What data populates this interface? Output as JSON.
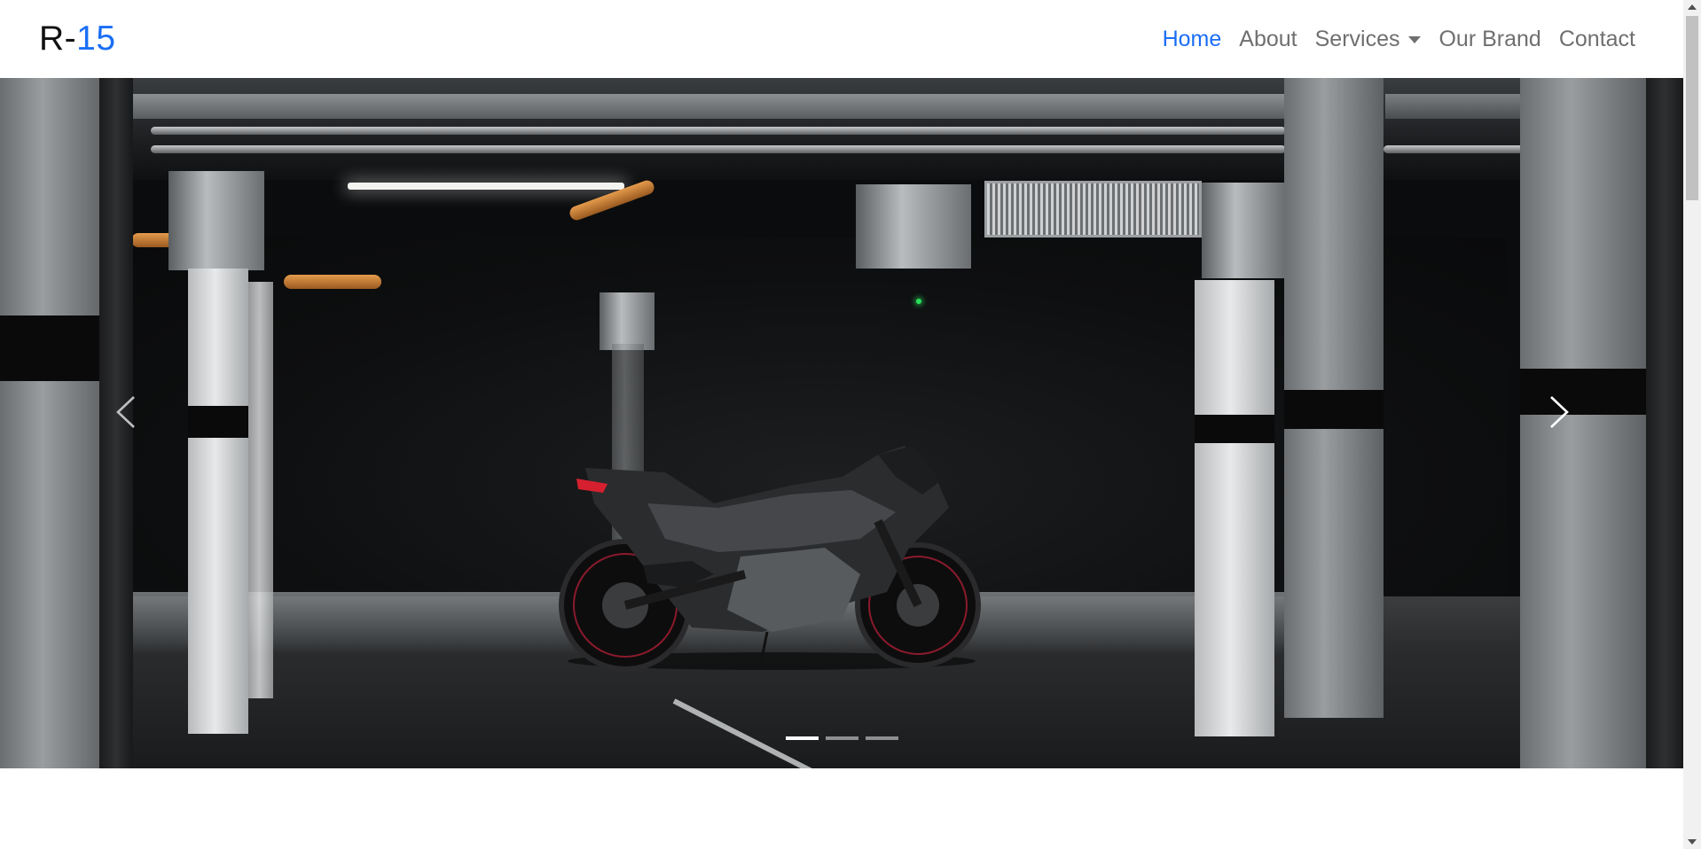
{
  "brand": {
    "prefix": "R-",
    "accent": "15"
  },
  "nav": {
    "items": [
      {
        "label": "Home",
        "active": true
      },
      {
        "label": "About",
        "active": false
      },
      {
        "label": "Services",
        "active": false,
        "dropdown": true
      },
      {
        "label": "Our Brand",
        "active": false
      },
      {
        "label": "Contact",
        "active": false
      }
    ]
  },
  "carousel": {
    "slide_count": 3,
    "active_index": 0,
    "prev_icon": "chevron-left-icon",
    "next_icon": "chevron-right-icon",
    "image_alt": "Black sport motorcycle parked in a dark underground garage"
  },
  "colors": {
    "accent": "#1a6ef5",
    "nav_text": "#6f6f6f",
    "brand_text": "#111111"
  }
}
